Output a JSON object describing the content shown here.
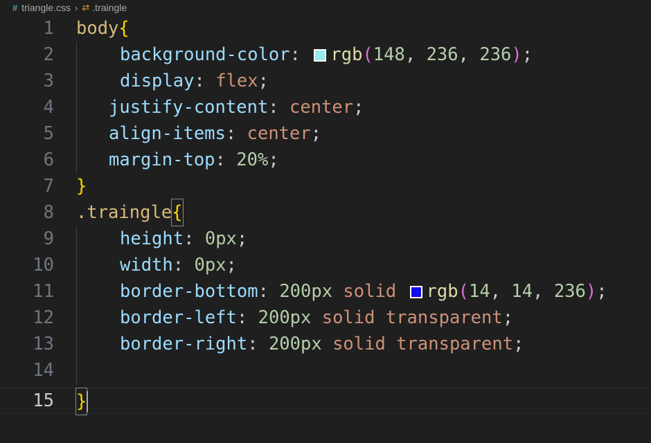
{
  "breadcrumb": {
    "file_icon": "hash-icon",
    "file": "triangle.css",
    "separator_icon": "chevron-right-icon",
    "symbol_icon": "css-selector-icon",
    "symbol": ".traingle"
  },
  "colors": {
    "swatch1": "#94ecec",
    "swatch2": "#0e0eec"
  },
  "lines": [
    {
      "n": "1",
      "t": [
        "body",
        "{"
      ]
    },
    {
      "n": "2",
      "t": [
        "background-color",
        ": ",
        "rgb",
        "(",
        "148",
        ", ",
        "236",
        ", ",
        "236",
        ")",
        ";"
      ]
    },
    {
      "n": "3",
      "t": [
        "display",
        ": ",
        "flex",
        ";"
      ]
    },
    {
      "n": "4",
      "t": [
        "justify-content",
        ": ",
        "center",
        ";"
      ]
    },
    {
      "n": "5",
      "t": [
        "align-items",
        ": ",
        "center",
        ";"
      ]
    },
    {
      "n": "6",
      "t": [
        "margin-top",
        ": ",
        "20%",
        ";"
      ]
    },
    {
      "n": "7",
      "t": [
        "}"
      ]
    },
    {
      "n": "8",
      "t": [
        ".traingle",
        "{"
      ]
    },
    {
      "n": "9",
      "t": [
        "height",
        ": ",
        "0px",
        ";"
      ]
    },
    {
      "n": "10",
      "t": [
        "width",
        ": ",
        "0px",
        ";"
      ]
    },
    {
      "n": "11",
      "t": [
        "border-bottom",
        ": ",
        "200px",
        " solid ",
        "rgb",
        "(",
        "14",
        ", ",
        "14",
        ", ",
        "236",
        ")",
        ";"
      ]
    },
    {
      "n": "12",
      "t": [
        "border-left",
        ": ",
        "200px",
        " solid transparent",
        ";"
      ]
    },
    {
      "n": "13",
      "t": [
        "border-right",
        ": ",
        "200px",
        " solid transparent",
        ";"
      ]
    },
    {
      "n": "14",
      "t": []
    },
    {
      "n": "15",
      "t": [
        "}"
      ]
    }
  ]
}
